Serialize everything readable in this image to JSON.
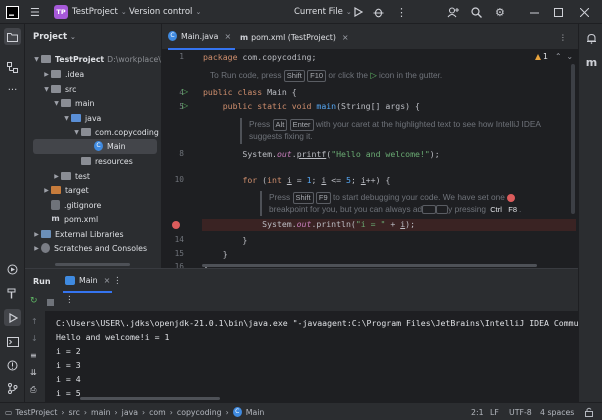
{
  "titlebar": {
    "menu_icon": "hamburger-icon",
    "project_badge": "TP",
    "project_name": "TestProject",
    "vcs": "Version control",
    "run_config": "Current File"
  },
  "project_panel": {
    "title": "Project",
    "items": [
      {
        "label": "TestProject",
        "suffix": "D:\\workplace\\Tes"
      },
      {
        "label": ".idea"
      },
      {
        "label": "src"
      },
      {
        "label": "main"
      },
      {
        "label": "java"
      },
      {
        "label": "com.copycoding"
      },
      {
        "label": "Main"
      },
      {
        "label": "resources"
      },
      {
        "label": "test"
      },
      {
        "label": "target"
      },
      {
        "label": ".gitignore"
      },
      {
        "label": "pom.xml"
      },
      {
        "label": "External Libraries"
      },
      {
        "label": "Scratches and Consoles"
      }
    ]
  },
  "editor": {
    "tabs": [
      {
        "label": "Main.java"
      },
      {
        "label": "pom.xml (TestProject)"
      }
    ],
    "warnings": "1",
    "line_numbers": [
      "1",
      "4",
      "5",
      "8",
      "10",
      "14",
      "15",
      "16"
    ],
    "hint1": {
      "pre": "To Run code, press",
      "k1": "Shift",
      "k2": "F10",
      "mid": "or click the",
      "post": "icon in the gutter."
    },
    "hint2": {
      "pre": "Press",
      "k1": "Alt",
      "k2": "Enter",
      "post": "with your caret at the highlighted text to see how IntelliJ IDEA",
      "line2": "suggests fixing it."
    },
    "hint3": {
      "pre": "Press",
      "k1": "Shift",
      "k2": "F9",
      "post": "to start debugging your code. We have set one",
      "line2a": "breakpoint for you, but you can always ad",
      "line2b": "y pressing",
      "k3": "Ctrl",
      "k4": "F8",
      "line2c": "."
    }
  },
  "run_panel": {
    "tab_run": "Run",
    "tab_main": "Main",
    "output": [
      "C:\\Users\\USER\\.jdks\\openjdk-21.0.1\\bin\\java.exe \"-javaagent:C:\\Program Files\\JetBrains\\IntelliJ IDEA Communi",
      "Hello and welcome!i = 1",
      "i = 2",
      "i = 3",
      "i = 4",
      "i = 5"
    ]
  },
  "statusbar": {
    "crumbs": [
      "TestProject",
      "src",
      "main",
      "java",
      "com",
      "copycoding",
      "Main"
    ],
    "position": "2:1",
    "line_sep": "LF",
    "encoding": "UTF-8",
    "indent": "4 spaces"
  }
}
